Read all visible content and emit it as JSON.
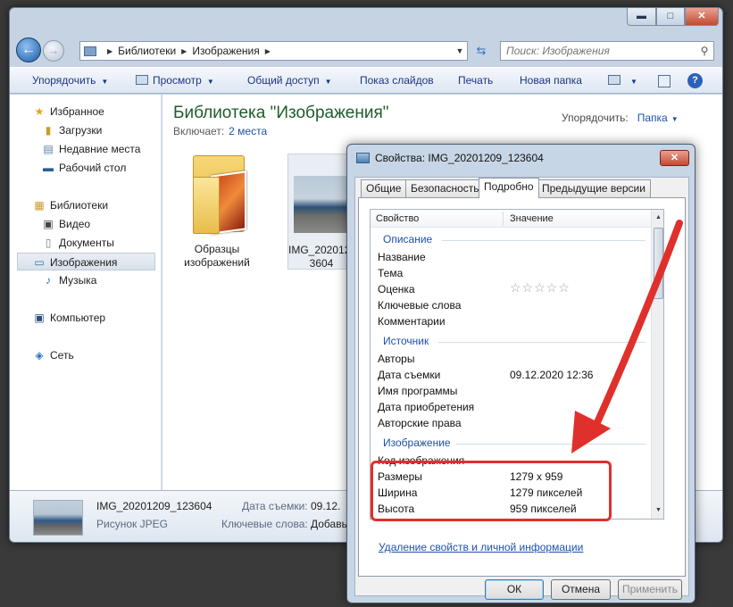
{
  "explorer": {
    "window_controls": {
      "minimize": "▬",
      "maximize": "□",
      "close": "✕"
    },
    "address": [
      "Библиотеки",
      "Изображения"
    ],
    "search_placeholder": "Поиск: Изображения",
    "toolbar": {
      "organize": "Упорядочить",
      "view": "Просмотр",
      "share": "Общий доступ",
      "slideshow": "Показ слайдов",
      "print": "Печать",
      "new_folder": "Новая папка",
      "help": "?"
    },
    "nav": {
      "favorites": "Избранное",
      "downloads": "Загрузки",
      "recent": "Недавние места",
      "desktop": "Рабочий стол",
      "libraries": "Библиотеки",
      "video": "Видео",
      "documents": "Документы",
      "pictures": "Изображения",
      "music": "Музыка",
      "computer": "Компьютер",
      "network": "Сеть"
    },
    "library": {
      "title": "Библиотека \"Изображения\"",
      "includes_label": "Включает:",
      "includes_value": "2 места",
      "arrange_label": "Упорядочить:",
      "arrange_value": "Папка"
    },
    "files": [
      {
        "name_line1": "Образцы",
        "name_line2": "изображений"
      },
      {
        "name_line1": "IMG_20201209",
        "name_line2": "3604"
      }
    ],
    "details": {
      "name": "IMG_20201209_123604",
      "type": "Рисунок JPEG",
      "date_label": "Дата съемки:",
      "date_value": "09.12.",
      "keywords_label": "Ключевые слова:",
      "keywords_value": "Добавь"
    }
  },
  "dialog": {
    "title": "Свойства: IMG_20201209_123604",
    "close": "✕",
    "tabs": [
      "Общие",
      "Безопасность",
      "Подробно",
      "Предыдущие версии"
    ],
    "active_tab": 2,
    "columns": {
      "property": "Свойство",
      "value": "Значение"
    },
    "groups": {
      "description": "Описание",
      "source": "Источник",
      "image": "Изображение"
    },
    "description_props": {
      "title": "Название",
      "subject": "Тема",
      "rating": "Оценка",
      "rating_stars": "☆☆☆☆☆",
      "keywords": "Ключевые слова",
      "comments": "Комментарии"
    },
    "source_props": {
      "authors": "Авторы",
      "date_taken": "Дата съемки",
      "date_taken_value": "09.12.2020 12:36",
      "program": "Имя программы",
      "date_acquired": "Дата приобретения",
      "copyright": "Авторские права"
    },
    "image_props": {
      "image_id": "Код изображения",
      "dimensions": "Размеры",
      "dimensions_value": "1279 x 959",
      "width": "Ширина",
      "width_value": "1279 пикселей",
      "height": "Высота",
      "height_value": "959 пикселей"
    },
    "remove_link": "Удаление свойств и личной информации",
    "buttons": {
      "ok": "ОК",
      "cancel": "Отмена",
      "apply": "Применить"
    }
  },
  "colors": {
    "annotation": "#e0302c",
    "link": "#1d4fae",
    "library_title": "#1e5d2a"
  }
}
